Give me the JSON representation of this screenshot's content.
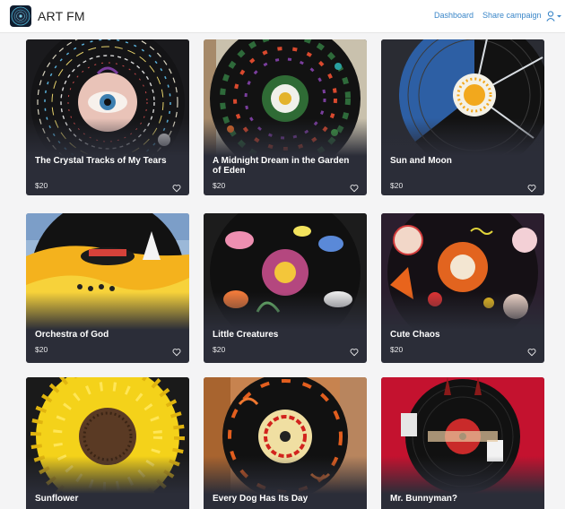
{
  "app": {
    "brand": "ART FM",
    "logo_icon": "vinyl-record-logo-icon",
    "accent_color": "#3a86c8"
  },
  "nav": {
    "dashboard": "Dashboard",
    "share_campaign": "Share campaign",
    "user_menu_icon": "user-dropdown-icon"
  },
  "items": [
    {
      "title": "The Crystal Tracks of My Tears",
      "price": "$20",
      "favorite_icon": "heart-outline-icon"
    },
    {
      "title": "A Midnight Dream in the Garden of Eden",
      "price": "$20",
      "favorite_icon": "heart-outline-icon"
    },
    {
      "title": "Sun and Moon",
      "price": "$20",
      "favorite_icon": "heart-outline-icon"
    },
    {
      "title": "Orchestra of God",
      "price": "$20",
      "favorite_icon": "heart-outline-icon"
    },
    {
      "title": "Little Creatures",
      "price": "$20",
      "favorite_icon": "heart-outline-icon"
    },
    {
      "title": "Cute Chaos",
      "price": "$20",
      "favorite_icon": "heart-outline-icon"
    },
    {
      "title": "Sunflower",
      "price": "",
      "favorite_icon": "heart-outline-icon"
    },
    {
      "title": "Every Dog Has Its Day",
      "price": "",
      "favorite_icon": "heart-outline-icon"
    },
    {
      "title": "Mr. Bunnyman?",
      "price": "",
      "favorite_icon": "heart-outline-icon"
    }
  ]
}
